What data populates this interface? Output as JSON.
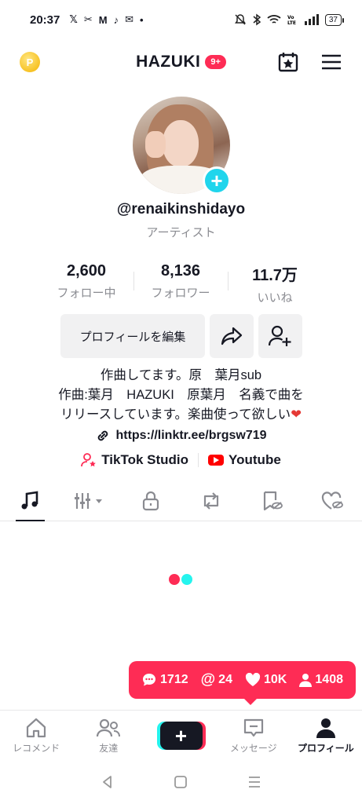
{
  "status_bar": {
    "time": "20:37",
    "left_icons": [
      "𝕏",
      "✂",
      "M",
      "♪",
      "✉",
      "•"
    ],
    "battery": "37"
  },
  "header": {
    "title": "HAZUKI",
    "badge": "9+"
  },
  "profile": {
    "username": "@renaikinshidayo",
    "category": "アーティスト"
  },
  "stats": [
    {
      "num": "2,600",
      "label": "フォロー中"
    },
    {
      "num": "8,136",
      "label": "フォロワー"
    },
    {
      "num": "11.7万",
      "label": "いいね"
    }
  ],
  "buttons": {
    "edit_profile": "プロフィールを編集"
  },
  "bio": {
    "line1": "作曲してます。原　葉月sub",
    "line2": "作曲:葉月　HAZUKI　原葉月　名義で曲を",
    "line3": "リリースしています。楽曲使って欲しい",
    "heart": "❤"
  },
  "link": "https://linktr.ee/brgsw719",
  "tags": {
    "studio": "TikTok Studio",
    "youtube": "Youtube"
  },
  "popup": {
    "comments": "1712",
    "mentions": "24",
    "likes": "10K",
    "followers": "1408"
  },
  "bottom_nav": {
    "home": "レコメンド",
    "friends": "友達",
    "messages": "メッセージ",
    "profile": "プロフィール"
  },
  "colors": {
    "accent": "#fe2c55",
    "cyan": "#25f4ee",
    "plus": "#20d5ec"
  }
}
